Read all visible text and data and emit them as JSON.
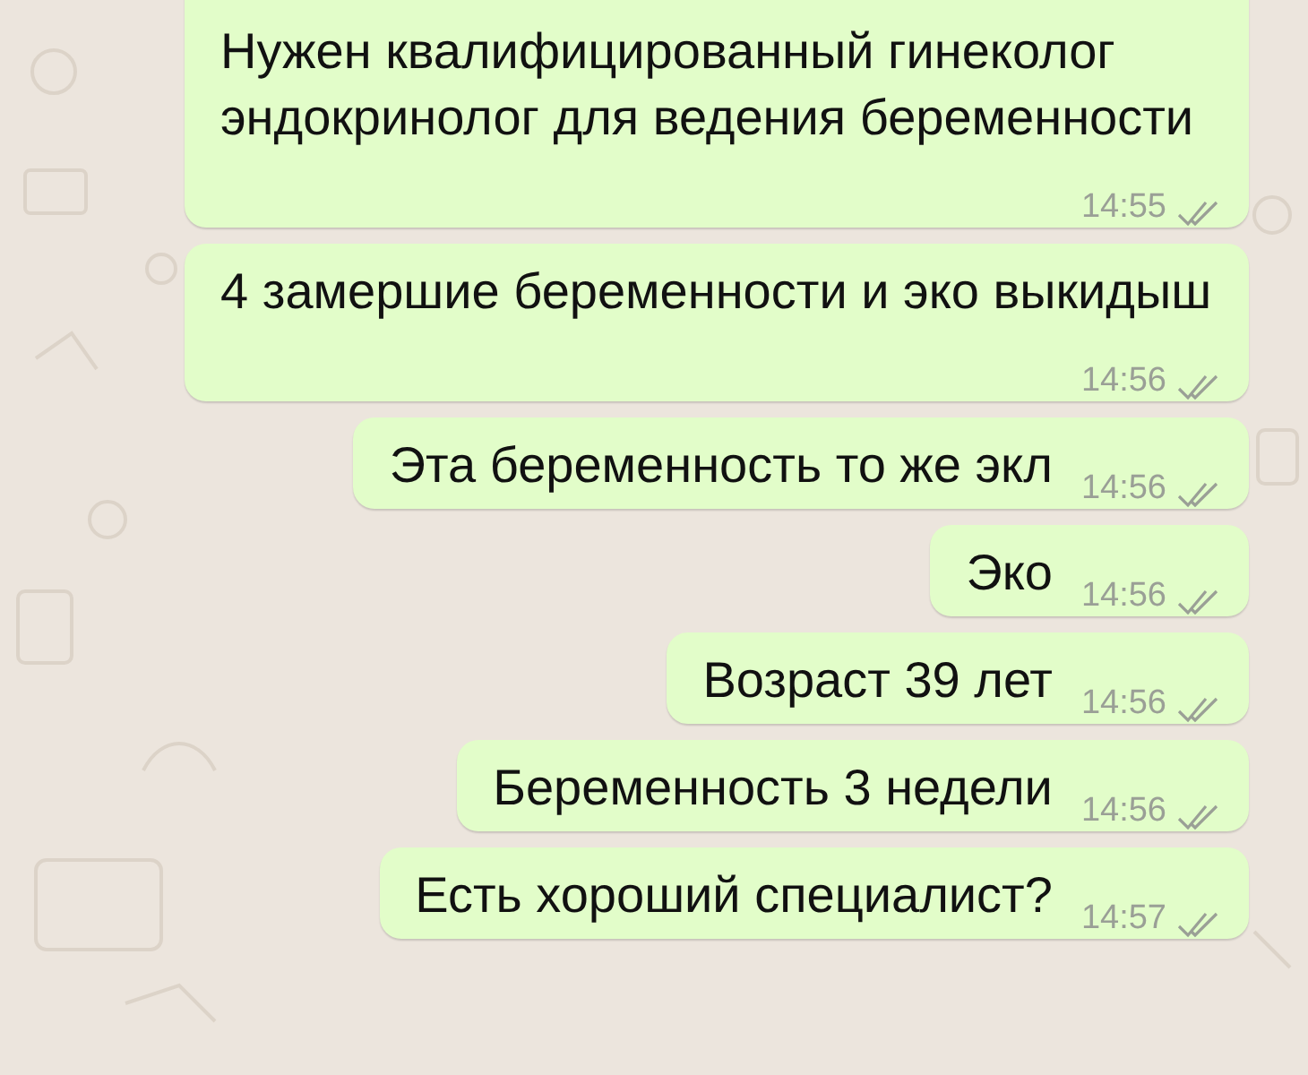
{
  "messages": [
    {
      "text": "Нужен квалифицированный гинеколог эндокринолог для ведения беременности",
      "time": "14:55",
      "read": false
    },
    {
      "text": "4 замершие беременности и эко выкидыш",
      "time": "14:56",
      "read": false
    },
    {
      "text": "Эта беременность то же экл",
      "time": "14:56",
      "read": false
    },
    {
      "text": "Эко",
      "time": "14:56",
      "read": false
    },
    {
      "text": "Возраст 39 лет",
      "time": "14:56",
      "read": false
    },
    {
      "text": "Беременность 3 недели",
      "time": "14:56",
      "read": false
    },
    {
      "text": "Есть хороший специалист?",
      "time": "14:57",
      "read": false
    }
  ]
}
